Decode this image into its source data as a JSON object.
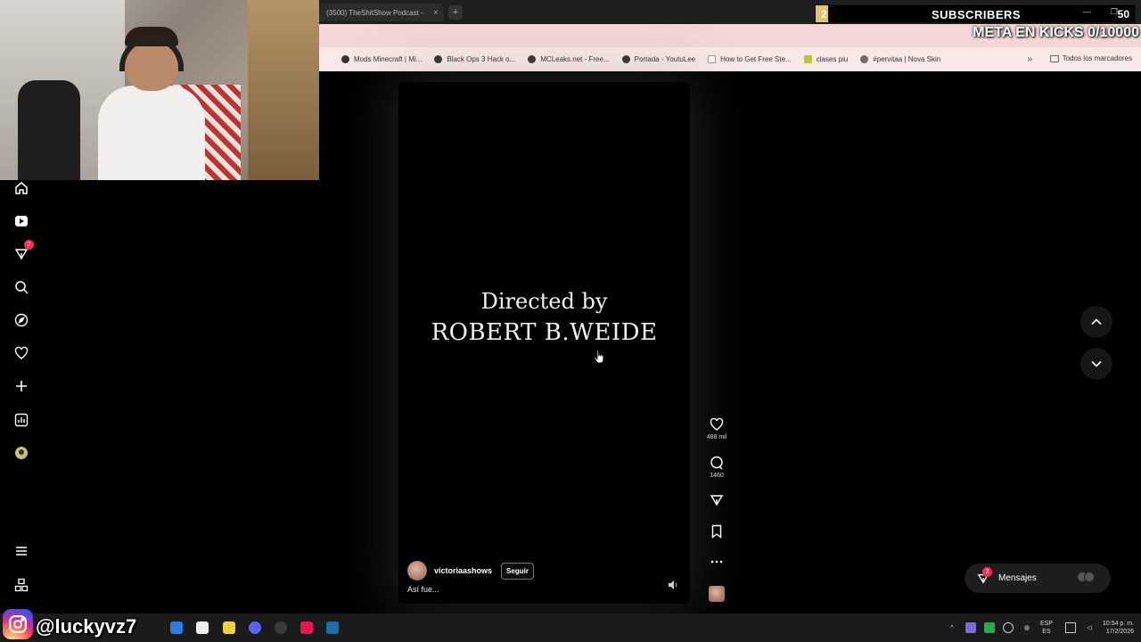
{
  "browser": {
    "tab_title": "(3500) TheShitShow Podcast -",
    "tab_close": "×",
    "new_tab": "+",
    "bookmarks": [
      {
        "label": "Mods Minecraft | Mi...",
        "icon": "globe-icon"
      },
      {
        "label": "Black Ops 3 Hack o...",
        "icon": "globe-icon"
      },
      {
        "label": "MCLeaks.net - Free...",
        "icon": "globe-icon"
      },
      {
        "label": "Portada - YoutuLee",
        "icon": "globe-icon"
      },
      {
        "label": "How to Get Free Ste...",
        "icon": "page-icon"
      },
      {
        "label": "clases piu",
        "icon": "image-icon"
      },
      {
        "label": "#pervitaa | Nova Skin",
        "icon": "gear-icon"
      }
    ],
    "bookmarks_more": "»",
    "all_bookmarks": "Todos los marcadores"
  },
  "overlay": {
    "subscribers_count": "2",
    "subscribers_label": "SUBSCRIBERS",
    "subscribers_goal": "50",
    "subscribers_progress": 0.04,
    "meta_text": "META EN KICKS 0/10000",
    "social_handle": "@luckyvz7"
  },
  "nav": {
    "notifications_badge": "2"
  },
  "video": {
    "credit_line1": "Directed by",
    "credit_line2": "ROBERT B.WEIDE",
    "author": "victoriaashows",
    "follow_label": "Seguir",
    "caption": "Así fue..."
  },
  "actions": {
    "likes": "488 mil",
    "comments": "1460"
  },
  "messages": {
    "label": "Mensajes",
    "badge": "2"
  },
  "taskbar": {
    "language_top": "ESP",
    "language_bottom": "ES",
    "time": "10:54 p. m.",
    "date": "17/2/2026"
  },
  "colors": {
    "accent": "#fe2c55",
    "subs_fill": "#e4c26a",
    "address_bar": "#f4d6d6"
  }
}
